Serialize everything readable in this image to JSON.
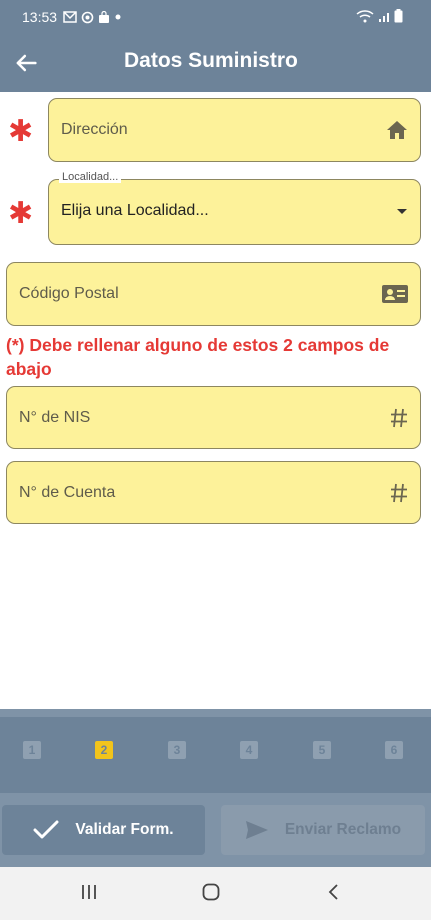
{
  "status_bar": {
    "time": "13:53"
  },
  "app_bar": {
    "title": "Datos Suministro"
  },
  "form": {
    "direccion": {
      "placeholder": "Dirección"
    },
    "localidad": {
      "label": "Localidad...",
      "value": "Elija una Localidad..."
    },
    "codigo_postal": {
      "placeholder": "Código Postal"
    },
    "warning": "(*) Debe rellenar alguno de estos 2 campos de abajo",
    "nis": {
      "placeholder": "N° de NIS"
    },
    "cuenta": {
      "placeholder": "N° de Cuenta"
    }
  },
  "steps": [
    {
      "label": "1",
      "active": false
    },
    {
      "label": "2",
      "active": true
    },
    {
      "label": "3",
      "active": false
    },
    {
      "label": "4",
      "active": false
    },
    {
      "label": "5",
      "active": false
    },
    {
      "label": "6",
      "active": false
    }
  ],
  "buttons": {
    "validar": "Validar Form.",
    "enviar": "Enviar Reclamo"
  },
  "icons": {
    "back": "arrow-left-icon",
    "direccion": "home-icon",
    "localidad": "dropdown-arrow-icon",
    "codigo_postal": "id-card-icon",
    "nis": "hash-icon",
    "cuenta": "hash-icon",
    "validar": "check-icon",
    "enviar": "send-icon"
  },
  "colors": {
    "primary": "#6d8399",
    "field_bg": "#fdf29a",
    "required": "#e53935",
    "active_step": "#f2c41b"
  }
}
